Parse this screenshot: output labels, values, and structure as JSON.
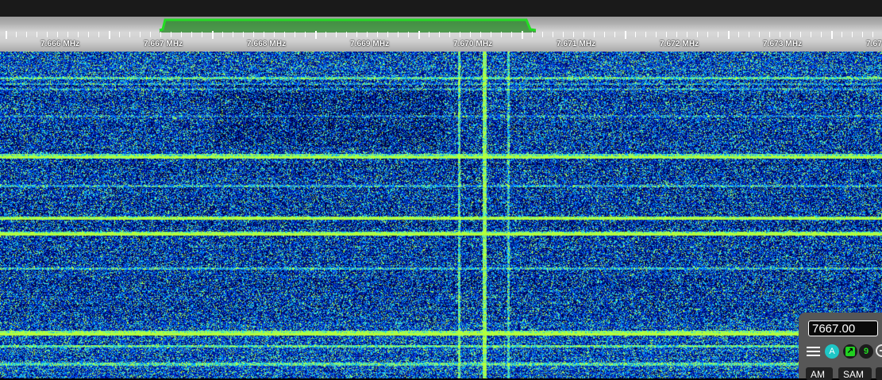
{
  "frequency_scale": {
    "labels": [
      "7.666 MHz",
      "7.667 MHz",
      "7.668 MHz",
      "7.669 MHz",
      "7.670 MHz",
      "7.671 MHz",
      "7.672 MHz",
      "7.673 MHz",
      "7.67"
    ]
  },
  "colors": {
    "passband": "#22dd22",
    "waterfall_background": "#000000",
    "signal_low": "#0a1a8a",
    "signal_mid": "#1e50ff",
    "signal_high": "#37e6d2",
    "signal_peak": "#b4ff3c",
    "agc_active": "#1ec6c6"
  },
  "control_panel": {
    "frequency_value": "7667.00",
    "icons": [
      "menu-icon",
      "agc-icon",
      "arrow-icon",
      "zoom-icon"
    ],
    "agc_label": "A",
    "arrow_label": "↗",
    "count_badge": "9",
    "modes": [
      "AM",
      "SAM",
      ""
    ]
  }
}
